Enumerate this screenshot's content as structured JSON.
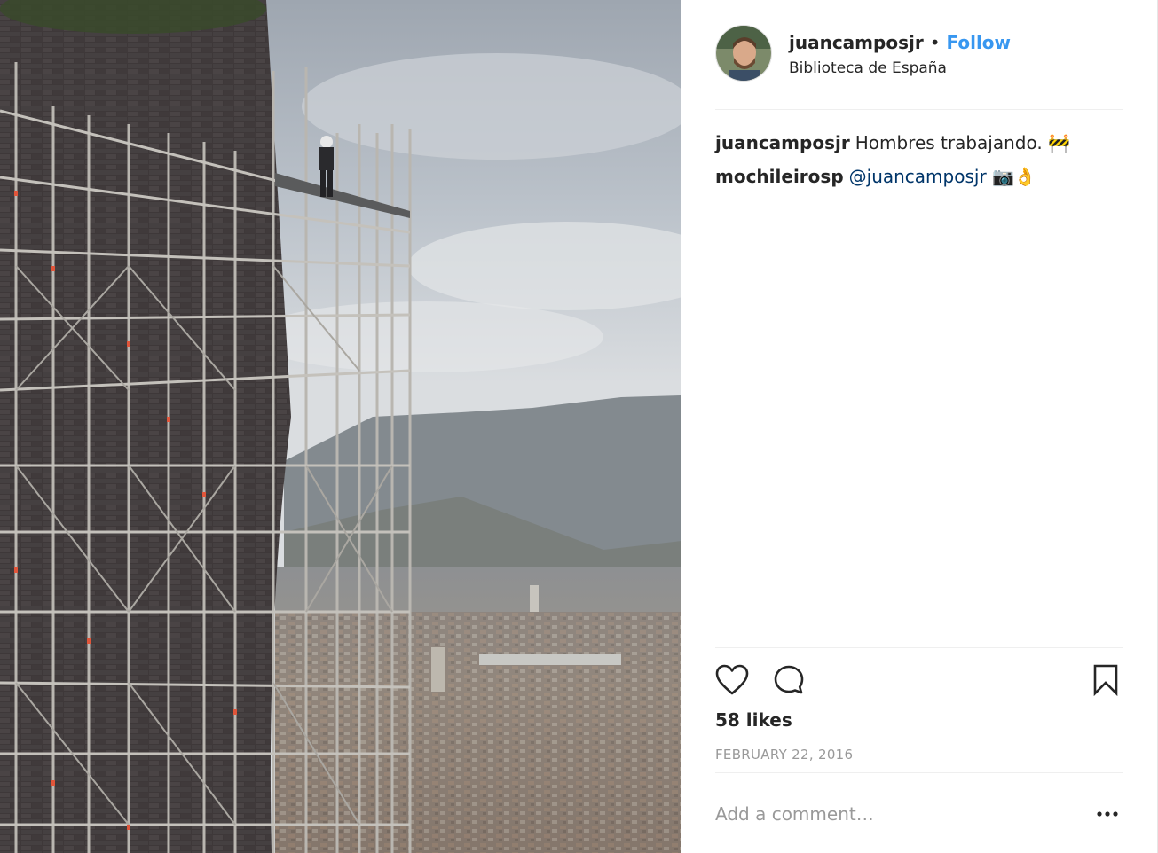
{
  "post": {
    "photo": {
      "alt_icon": "photo-scaffolding"
    },
    "header": {
      "username": "juancamposjr",
      "separator": "•",
      "follow_label": "Follow",
      "location": "Biblioteca de España",
      "avatar_icon": "user-avatar"
    },
    "comments": [
      {
        "user": "juancamposjr",
        "text": "Hombres trabajando.",
        "emoji": "🚧"
      },
      {
        "user": "mochileirosp",
        "mention": "@juancamposjr",
        "emoji": "📷👌"
      }
    ],
    "actions": {
      "like_icon": "heart-icon",
      "comment_icon": "comment-icon",
      "save_icon": "bookmark-icon"
    },
    "likes": "58 likes",
    "date": "FEBRUARY 22, 2016",
    "add_comment": {
      "placeholder": "Add a comment…",
      "more_icon": "more-options-icon"
    }
  },
  "colors": {
    "accent": "#3897f0",
    "mention": "#003569",
    "muted": "#999999",
    "text": "#262626"
  }
}
